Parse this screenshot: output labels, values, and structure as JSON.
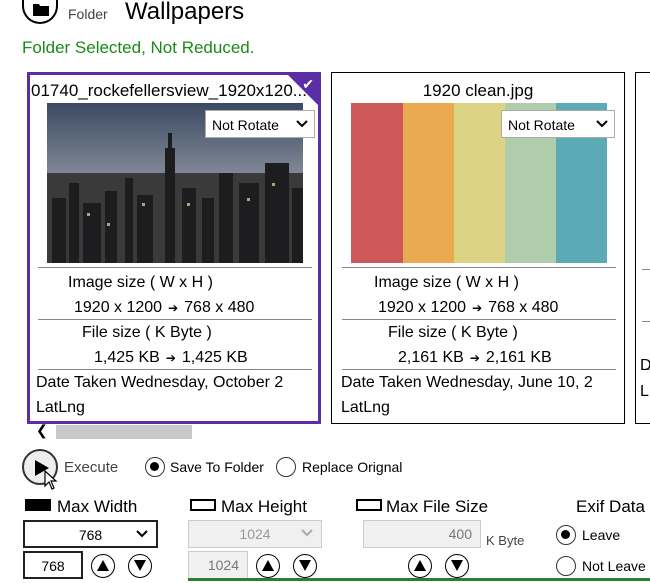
{
  "header": {
    "folder_label": "Folder",
    "title": "Wallpapers",
    "status": "Folder Selected, Not Reduced."
  },
  "cards": [
    {
      "title": "01740_rockefellersview_1920x120...",
      "rotate": "Not Rotate",
      "size_label": "Image   size ( W x H )",
      "size_from": "1920 x 1200",
      "size_to": "768 x 480",
      "file_label": "File size ( K Byte )",
      "file_from": "1,425 KB",
      "file_to": "1,425 KB",
      "date": "Date Taken  Wednesday, October 2",
      "latlng": "LatLng",
      "selected": true
    },
    {
      "title": "1920 clean.jpg",
      "rotate": "Not Rotate",
      "size_label": "Image   size ( W x H )",
      "size_from": "1920 x 1200",
      "size_to": "768 x 480",
      "file_label": "File size ( K Byte )",
      "file_from": "2,161 KB",
      "file_to": "2,161 KB",
      "date": "Date Taken  Wednesday, June 10, 2",
      "latlng": "LatLng",
      "selected": false
    },
    {
      "partial_date": "D",
      "partial_latlng": "L"
    }
  ],
  "execute": {
    "label": "Execute",
    "save_to_folder": "Save To Folder",
    "replace_original": "Replace Orignal",
    "selected": "save_to_folder"
  },
  "max_width": {
    "label": "Max Width",
    "dropdown": "768",
    "value": "768"
  },
  "max_height": {
    "label": "Max Height",
    "dropdown": "1024",
    "value": "1024"
  },
  "max_file_size": {
    "label": "Max File Size",
    "value": "400",
    "unit": "K Byte"
  },
  "exif": {
    "label": "Exif Data",
    "leave": "Leave",
    "not_leave": "Not Leave",
    "selected": "leave"
  },
  "colors": {
    "accent": "#5b2ea6",
    "status_green": "#1a8a1a"
  }
}
